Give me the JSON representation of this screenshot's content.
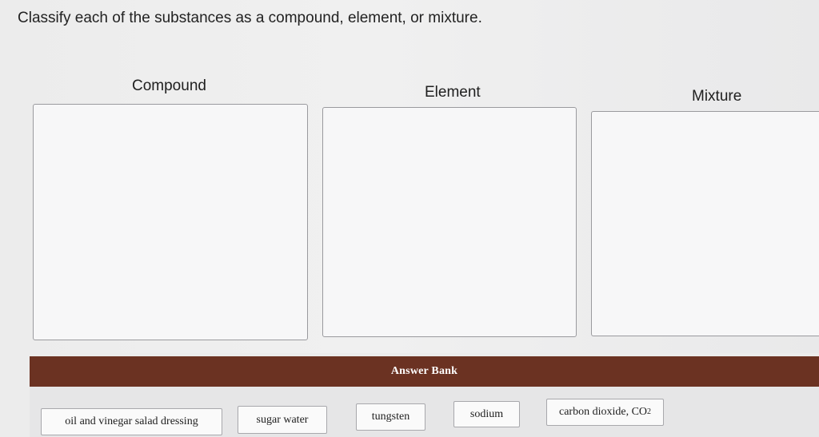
{
  "instruction": "Classify each of the substances as a compound, element, or mixture.",
  "categories": [
    {
      "id": "compound",
      "label": "Compound"
    },
    {
      "id": "element",
      "label": "Element"
    },
    {
      "id": "mixture",
      "label": "Mixture"
    }
  ],
  "answer_bank": {
    "title": "Answer Bank",
    "items": [
      {
        "label": "oil and vinegar salad dressing"
      },
      {
        "label": "sugar water"
      },
      {
        "label": "tungsten"
      },
      {
        "label": "sodium"
      },
      {
        "label": "carbon dioxide, CO",
        "subscript": "2"
      }
    ]
  },
  "colors": {
    "answer_bank_header": "#6b3222",
    "drop_zone_border": "#9a9a9e",
    "chip_border": "#a8a8ac"
  }
}
